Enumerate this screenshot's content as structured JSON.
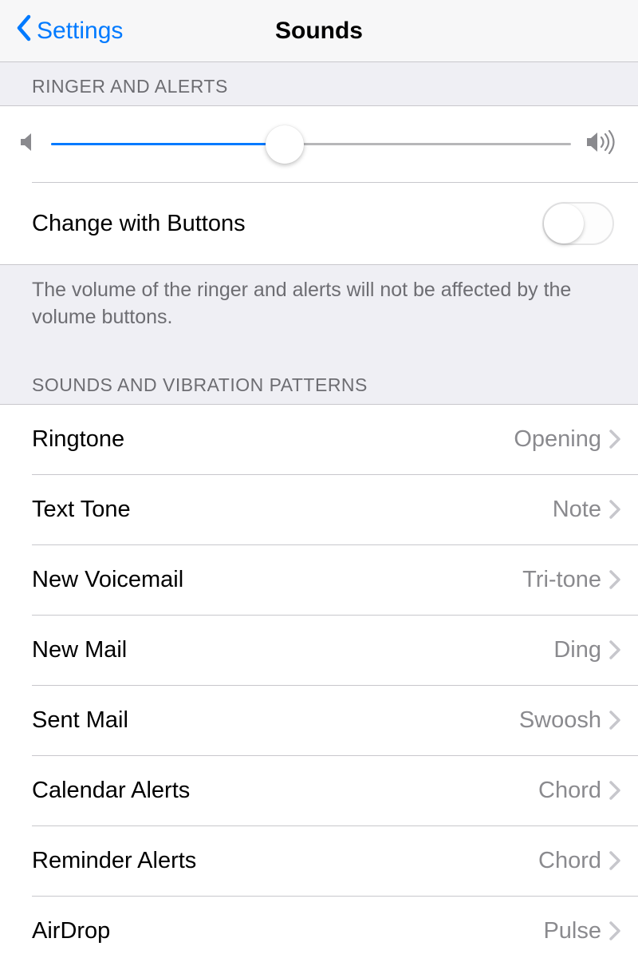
{
  "nav": {
    "back_label": "Settings",
    "title": "Sounds"
  },
  "sections": {
    "ringer": {
      "header": "Ringer and Alerts",
      "change_with_buttons_label": "Change with Buttons",
      "footer": "The volume of the ringer and alerts will not be affected by the volume buttons."
    },
    "patterns": {
      "header": "Sounds and Vibration Patterns",
      "items": [
        {
          "label": "Ringtone",
          "value": "Opening"
        },
        {
          "label": "Text Tone",
          "value": "Note"
        },
        {
          "label": "New Voicemail",
          "value": "Tri-tone"
        },
        {
          "label": "New Mail",
          "value": "Ding"
        },
        {
          "label": "Sent Mail",
          "value": "Swoosh"
        },
        {
          "label": "Calendar Alerts",
          "value": "Chord"
        },
        {
          "label": "Reminder Alerts",
          "value": "Chord"
        },
        {
          "label": "AirDrop",
          "value": "Pulse"
        }
      ]
    }
  }
}
